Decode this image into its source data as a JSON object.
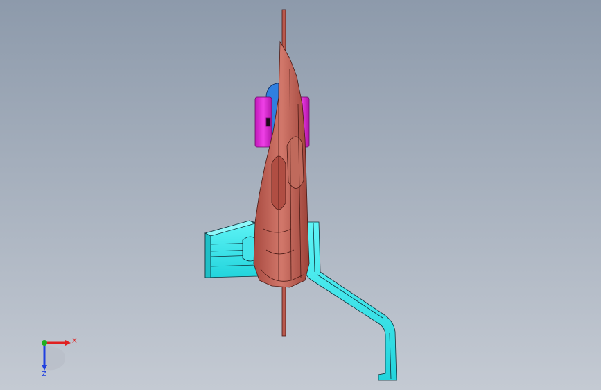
{
  "colors": {
    "background_top": "#8d9aab",
    "background_bottom": "#c4cad3",
    "plate": "#c8665a",
    "plate_dark": "#8e3b33",
    "plate_edge": "#4a1a15",
    "clamp": "#e020d8",
    "clamp_dark": "#9a1496",
    "cap": "#2f7fe0",
    "bracket": "#2ee8ee",
    "bracket_dark": "#1aa8b0",
    "edge": "#10303a",
    "axis_x": "#e02020",
    "axis_y": "#20b020",
    "axis_z": "#2040e0"
  },
  "triad": {
    "x_label": "X",
    "z_label": "Z"
  }
}
